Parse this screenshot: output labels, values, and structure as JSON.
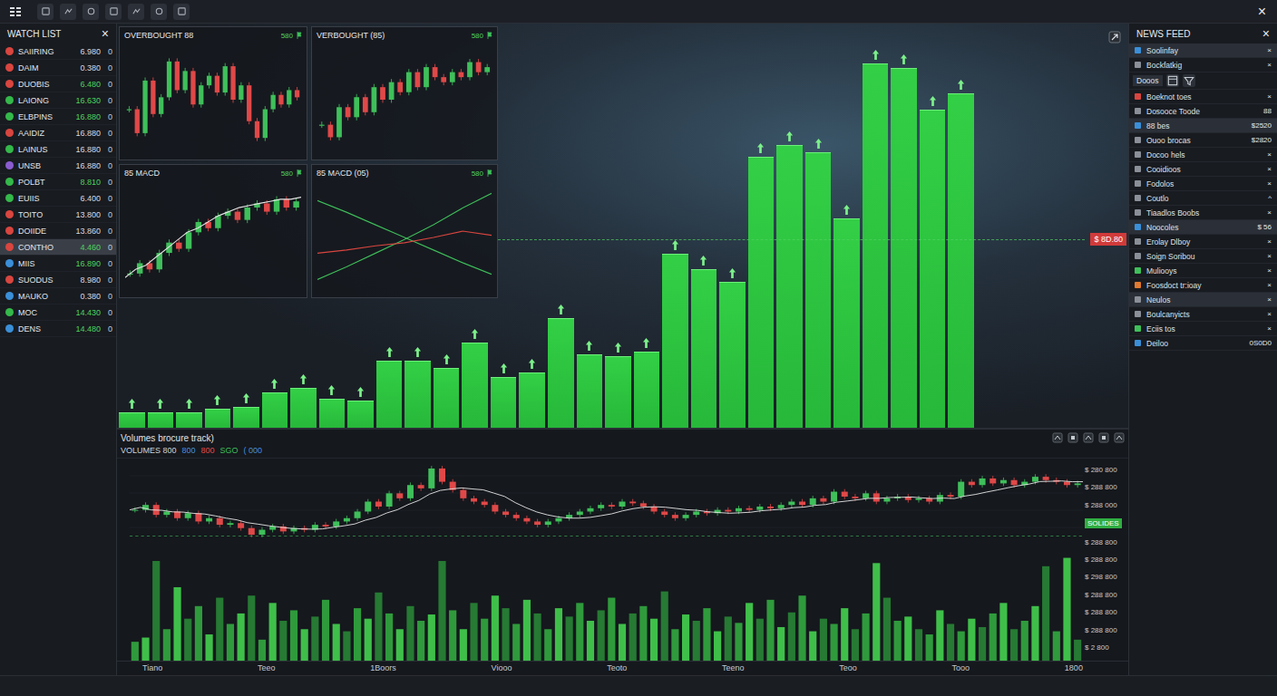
{
  "toolbar": {
    "close": "×"
  },
  "watch_list": {
    "title": "WATCH LIST",
    "close": "×",
    "items": [
      {
        "name": "SAIIRING",
        "value": "6.980",
        "change": "0",
        "color": "#d9453f",
        "up": false,
        "selected": false
      },
      {
        "name": "DAIM",
        "value": "0.380",
        "change": "0",
        "color": "#d9453f",
        "up": false,
        "selected": false
      },
      {
        "name": "DUOBIS",
        "value": "6.480",
        "change": "0",
        "color": "#d9453f",
        "up": true,
        "selected": false
      },
      {
        "name": "LAIONG",
        "value": "16.630",
        "change": "0",
        "color": "#34b84a",
        "up": true,
        "selected": false
      },
      {
        "name": "ELBPINS",
        "value": "16.880",
        "change": "0",
        "color": "#34b84a",
        "up": true,
        "selected": false
      },
      {
        "name": "AAIDIZ",
        "value": "16.880",
        "change": "0",
        "color": "#d9453f",
        "up": false,
        "selected": false
      },
      {
        "name": "LAINUS",
        "value": "16.880",
        "change": "0",
        "color": "#34b84a",
        "up": false,
        "selected": false
      },
      {
        "name": "UNSB",
        "value": "16.880",
        "change": "0",
        "color": "#8a5cd0",
        "up": false,
        "selected": false
      },
      {
        "name": "POLBT",
        "value": "8.810",
        "change": "0",
        "color": "#34b84a",
        "up": true,
        "selected": false
      },
      {
        "name": "EUIIS",
        "value": "6.400",
        "change": "0",
        "color": "#34b84a",
        "up": false,
        "selected": false
      },
      {
        "name": "TOITO",
        "value": "13.800",
        "change": "0",
        "color": "#d9453f",
        "up": false,
        "selected": false
      },
      {
        "name": "DOIIDE",
        "value": "13.860",
        "change": "0",
        "color": "#d9453f",
        "up": false,
        "selected": false
      },
      {
        "name": "CONTHO",
        "value": "4.460",
        "change": "0",
        "color": "#d9453f",
        "up": true,
        "selected": true
      },
      {
        "name": "MIIS",
        "value": "16.890",
        "change": "0",
        "color": "#3a8fd8",
        "up": true,
        "selected": false
      },
      {
        "name": "SUODUS",
        "value": "8.980",
        "change": "0",
        "color": "#d9453f",
        "up": false,
        "selected": false
      },
      {
        "name": "MAUKO",
        "value": "0.380",
        "change": "0",
        "color": "#3a8fd8",
        "up": false,
        "selected": false
      },
      {
        "name": "MOC",
        "value": "14.430",
        "change": "0",
        "color": "#34b84a",
        "up": true,
        "selected": false
      },
      {
        "name": "DENS",
        "value": "14.480",
        "change": "0",
        "color": "#3a8fd8",
        "up": true,
        "selected": false
      }
    ]
  },
  "mini_charts": [
    {
      "title": "OVERBOUGHT 88",
      "badge": "580",
      "kind": "candles",
      "closes": [
        50,
        40,
        62,
        48,
        55,
        70,
        58,
        66,
        52,
        60,
        64,
        57,
        68,
        54,
        60,
        45,
        38,
        50,
        56,
        52,
        58,
        55
      ],
      "lines": []
    },
    {
      "title": "VERBOUGHT (85)",
      "badge": "580",
      "kind": "candles",
      "closes": [
        45,
        40,
        52,
        48,
        56,
        50,
        60,
        55,
        62,
        58,
        66,
        60,
        68,
        64,
        62,
        66,
        64,
        70,
        66,
        68
      ],
      "lines": []
    },
    {
      "title": "85 MACD",
      "badge": "580",
      "kind": "candles",
      "closes": [
        30,
        35,
        32,
        40,
        45,
        42,
        50,
        55,
        52,
        58,
        60,
        56,
        62,
        64,
        60,
        66,
        62,
        65
      ],
      "lines": [
        {
          "color": "#e6e6e6",
          "values": [
            28,
            32,
            34,
            38,
            42,
            46,
            50,
            52,
            55,
            58,
            60,
            62,
            63,
            64,
            65,
            66,
            66,
            67
          ]
        }
      ]
    },
    {
      "title": "85 MACD (05)",
      "badge": "580",
      "kind": "lines",
      "closes": [],
      "lines": [
        {
          "color": "#3fbf5a",
          "values": [
            85,
            74,
            62,
            50,
            38,
            26,
            15
          ]
        },
        {
          "color": "#3fbf5a",
          "values": [
            10,
            22,
            35,
            48,
            62,
            78,
            92
          ]
        },
        {
          "color": "#d9453f",
          "values": [
            35,
            38,
            42,
            45,
            50,
            56,
            52
          ]
        }
      ]
    }
  ],
  "bar_chart": {
    "values": [
      16,
      16,
      16,
      20,
      22,
      38,
      43,
      31,
      29,
      73,
      73,
      65,
      93,
      55,
      60,
      120,
      80,
      78,
      83,
      191,
      174,
      160,
      298,
      311,
      303,
      230,
      401,
      396,
      350,
      368
    ]
  },
  "price_tag": "$ 8D.80",
  "volume_chart": {
    "title": "Volumes brocure track)",
    "legend": [
      {
        "text": "VOLUMES 800",
        "color": "#d0d4da"
      },
      {
        "text": "800",
        "color": "#4a90d9"
      },
      {
        "text": "800",
        "color": "#e04848"
      },
      {
        "text": "SGO",
        "color": "#3fbf5a"
      },
      {
        "text": "( 000",
        "color": "#4a90d9"
      }
    ],
    "closes": [
      45,
      48,
      42,
      44,
      40,
      43,
      38,
      40,
      36,
      37,
      34,
      30,
      33,
      35,
      32,
      34,
      33,
      36,
      35,
      38,
      40,
      44,
      50,
      47,
      55,
      52,
      60,
      58,
      70,
      62,
      57,
      52,
      50,
      48,
      44,
      42,
      40,
      38,
      36,
      38,
      40,
      42,
      44,
      46,
      48,
      47,
      50,
      49,
      47,
      44,
      42,
      40,
      42,
      44,
      43,
      45,
      44,
      46,
      45,
      47,
      46,
      48,
      50,
      48,
      52,
      50,
      56,
      53,
      52,
      55,
      50,
      52,
      53,
      51,
      52,
      50,
      54,
      53,
      62,
      60,
      64,
      61,
      63,
      60,
      62,
      65,
      63,
      62,
      60,
      61
    ],
    "volumes": [
      18,
      22,
      95,
      30,
      70,
      40,
      52,
      25,
      60,
      35,
      45,
      62,
      20,
      55,
      38,
      48,
      30,
      42,
      58,
      35,
      28,
      50,
      40,
      65,
      45,
      30,
      52,
      38,
      44,
      95,
      48,
      30,
      55,
      40,
      62,
      50,
      35,
      58,
      45,
      30,
      50,
      42,
      55,
      38,
      48,
      60,
      35,
      45,
      52,
      40,
      66,
      30,
      44,
      38,
      50,
      28,
      42,
      36,
      55,
      40,
      58,
      32,
      46,
      62,
      28,
      40,
      35,
      50,
      30,
      45,
      93,
      60,
      38,
      42,
      30,
      25,
      48,
      35,
      28,
      40,
      32,
      45,
      55,
      30,
      38,
      52,
      90,
      28,
      98,
      20
    ],
    "y_axis": [
      {
        "text": "$ 280 800",
        "kind": "label"
      },
      {
        "text": "$ 288 800",
        "kind": "label"
      },
      {
        "text": "$ 288 000",
        "kind": "label"
      },
      {
        "text": "SOLIDES",
        "kind": "tag"
      },
      {
        "text": "$ 288 800",
        "kind": "label"
      },
      {
        "text": "$ 288 800",
        "kind": "label"
      },
      {
        "text": "$ 298 800",
        "kind": "label"
      },
      {
        "text": "$ 288 800",
        "kind": "label"
      },
      {
        "text": "$ 288 800",
        "kind": "label"
      },
      {
        "text": "$ 288 800",
        "kind": "label"
      },
      {
        "text": "$ 2 800",
        "kind": "label"
      }
    ],
    "x_axis": [
      "Tiano",
      "Teeo",
      "1Boors",
      "Viooo",
      "Teoto",
      "Teeno",
      "Teoo",
      "Tooo",
      "1800"
    ]
  },
  "news_feed": {
    "title": "NEWS FEED",
    "close": "×",
    "pinned": [
      {
        "text": "Soolinfay",
        "trail": "×",
        "color": "#3a8fd8",
        "selected": true
      },
      {
        "text": "Bockfatkig",
        "trail": "×",
        "color": "#8a8f98",
        "selected": false
      }
    ],
    "tab": {
      "label": "Dooos",
      "selected": true
    },
    "items": [
      {
        "text": "Boeknot toes",
        "trail": "×",
        "color": "#d9453f",
        "selected": false
      },
      {
        "text": "Dosooce Toode",
        "trail": "88",
        "color": "#8a8f98",
        "selected": false
      },
      {
        "text": "88 bes",
        "trail": "$2520",
        "color": "#3a8fd8",
        "selected": true
      },
      {
        "text": "Ouoo brocas",
        "trail": "$2820",
        "color": "#8a8f98",
        "selected": false
      },
      {
        "text": "Docoo hels",
        "trail": "×",
        "color": "#8a8f98",
        "selected": false
      },
      {
        "text": "Cooidioos",
        "trail": "×",
        "color": "#8a8f98",
        "selected": false
      },
      {
        "text": "Fodolos",
        "trail": "×",
        "color": "#8a8f98",
        "selected": false
      },
      {
        "text": "Coutlo",
        "trail": "^",
        "color": "#8a8f98",
        "selected": false
      },
      {
        "text": "Tiaadlos Boobs",
        "trail": "×",
        "color": "#8a8f98",
        "selected": false
      },
      {
        "text": "Noocoles",
        "trail": "$ 56",
        "color": "#3a8fd8",
        "selected": true
      },
      {
        "text": "Erolay Dlboy",
        "trail": "×",
        "color": "#8a8f98",
        "selected": false
      },
      {
        "text": "Soign Soribou",
        "trail": "×",
        "color": "#8a8f98",
        "selected": false
      },
      {
        "text": "Muliooys",
        "trail": "×",
        "color": "#3fbf5a",
        "selected": false
      },
      {
        "text": "Foosdoct tr:ioay",
        "trail": "×",
        "color": "#e07a30",
        "selected": false
      },
      {
        "text": "Neulos",
        "trail": "×",
        "color": "#8a8f98",
        "selected": true
      },
      {
        "text": "Boulcanyicts",
        "trail": "×",
        "color": "#8a8f98",
        "selected": false
      },
      {
        "text": "Eciis tos",
        "trail": "×",
        "color": "#3fbf5a",
        "selected": false
      },
      {
        "text": "Deiloo",
        "trail": "0S0D0",
        "color": "#3a8fd8",
        "selected": false
      }
    ]
  }
}
